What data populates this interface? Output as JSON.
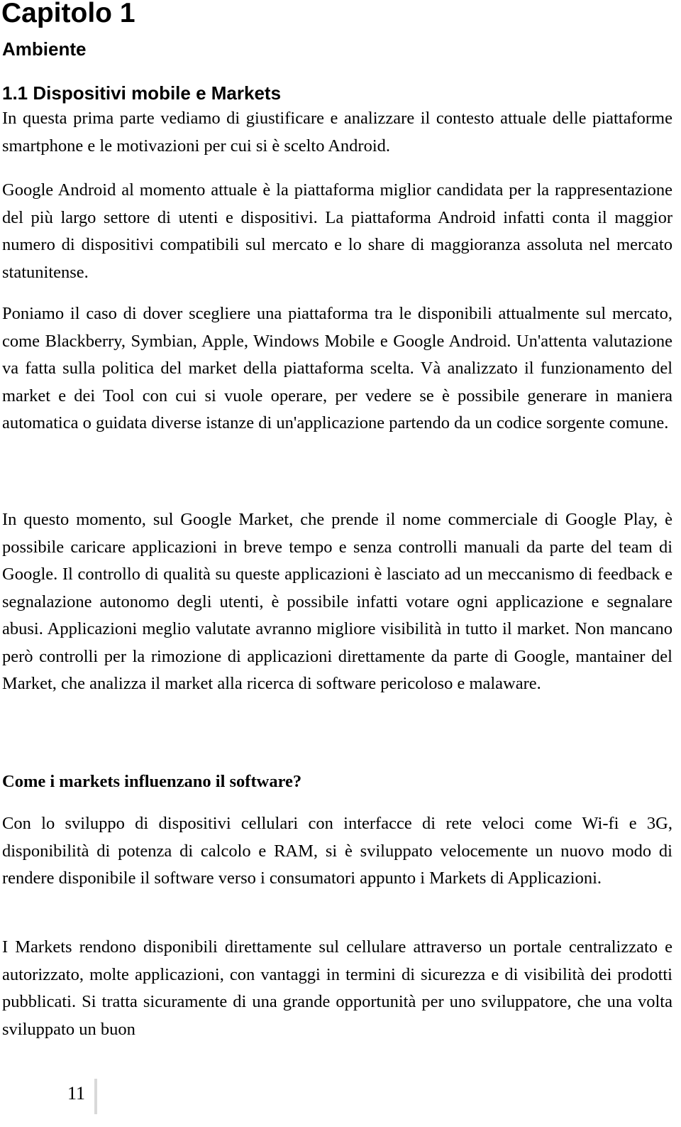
{
  "chapter": {
    "label": "Capitolo 1",
    "title": "Ambiente"
  },
  "section": {
    "title": "1.1 Dispositivi mobile e Markets"
  },
  "paragraphs": [
    "In questa prima parte vediamo di giustificare e analizzare il contesto attuale delle piattaforme smartphone e le motivazioni per cui si è scelto Android.",
    "Google Android al momento attuale è la piattaforma miglior candidata per la rappresentazione del più largo settore di utenti e dispositivi. La piattaforma Android infatti conta il maggior numero di dispositivi compatibili sul mercato e lo share di maggioranza assoluta nel mercato statunitense.",
    "Poniamo il caso di dover scegliere una piattaforma tra le disponibili attualmente sul mercato, come Blackberry, Symbian, Apple, Windows Mobile e Google Android. Un'attenta valutazione va fatta sulla politica del market della piattaforma scelta. Và analizzato il funzionamento del market e dei Tool con cui si vuole operare, per vedere se è possibile generare in maniera automatica o guidata diverse istanze di un'applicazione partendo da un codice sorgente comune.",
    "In questo momento, sul Google Market, che prende il nome commerciale di Google Play, è possibile caricare applicazioni in breve tempo e senza controlli manuali da parte del team di Google. Il controllo di qualità su queste applicazioni è lasciato ad un meccanismo di feedback e segnalazione autonomo degli utenti, è possibile infatti votare ogni applicazione e segnalare abusi. Applicazioni meglio valutate avranno migliore visibilità in tutto il market. Non mancano però controlli per la rimozione di applicazioni direttamente da parte di Google, mantainer del Market, che analizza il market alla ricerca di software pericoloso e malaware."
  ],
  "subheading": "Come i markets influenzano il software?",
  "paragraphs2": [
    "Con lo sviluppo di dispositivi cellulari con interfacce di rete veloci come Wi-fi e 3G, disponibilità di potenza di calcolo e RAM, si è sviluppato velocemente un nuovo modo di rendere disponibile il software verso i consumatori appunto i Markets di Applicazioni.",
    "I Markets rendono disponibili direttamente sul cellulare attraverso un portale centralizzato e autorizzato, molte applicazioni, con vantaggi in termini di sicurezza e di visibilità dei prodotti pubblicati. Si tratta sicuramente di una grande opportunità per uno sviluppatore, che una volta sviluppato un buon"
  ],
  "footer": {
    "page_number": "11"
  }
}
